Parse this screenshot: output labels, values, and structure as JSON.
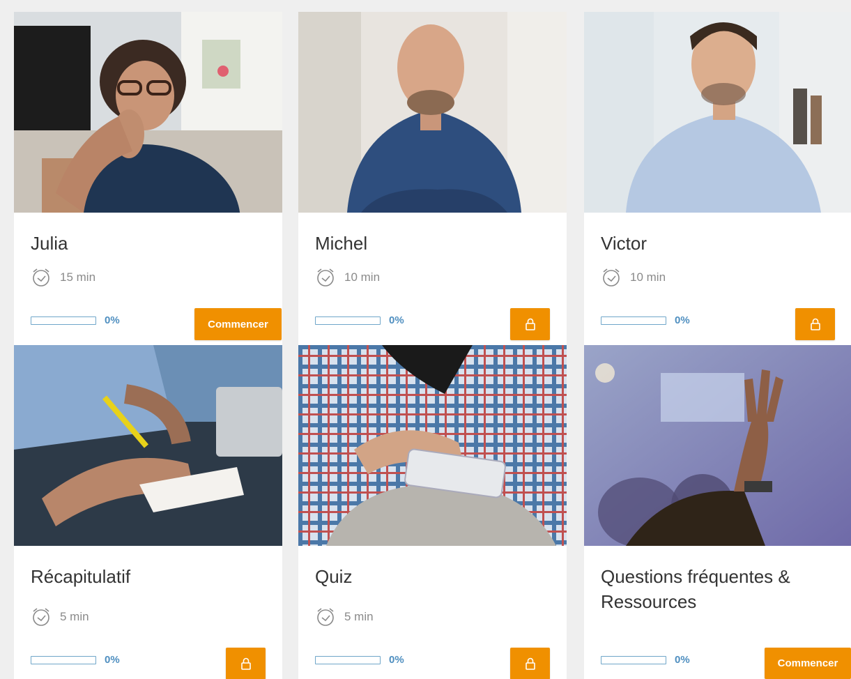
{
  "accent_color": "#f09000",
  "progress_color": "#4f8fc0",
  "cards": [
    {
      "title": "Julia",
      "duration": "15 min",
      "progress_label": "0%",
      "progress_value": 0,
      "action": "start",
      "action_label": "Commencer",
      "photo": "portrait-woman-glasses",
      "clock_icon": "alarm-clock-icon"
    },
    {
      "title": "Michel",
      "duration": "10 min",
      "progress_label": "0%",
      "progress_value": 0,
      "action": "locked",
      "action_label": "",
      "photo": "portrait-bald-man",
      "clock_icon": "alarm-clock-icon"
    },
    {
      "title": "Victor",
      "duration": "10 min",
      "progress_label": "0%",
      "progress_value": 0,
      "action": "locked",
      "action_label": "",
      "photo": "portrait-young-man",
      "clock_icon": "alarm-clock-icon"
    },
    {
      "title": "Récapitulatif",
      "duration": "5 min",
      "progress_label": "0%",
      "progress_value": 0,
      "action": "locked",
      "action_label": "",
      "photo": "hand-writing-notes",
      "clock_icon": "alarm-clock-icon"
    },
    {
      "title": "Quiz",
      "duration": "5 min",
      "progress_label": "0%",
      "progress_value": 0,
      "action": "locked",
      "action_label": "",
      "photo": "hands-holding-phone",
      "clock_icon": "alarm-clock-icon"
    },
    {
      "title": "Questions fréquentes & Ressources",
      "duration": "",
      "progress_label": "0%",
      "progress_value": 0,
      "action": "start",
      "action_label": "Commencer",
      "photo": "raised-hand-audience",
      "clock_icon": ""
    }
  ]
}
